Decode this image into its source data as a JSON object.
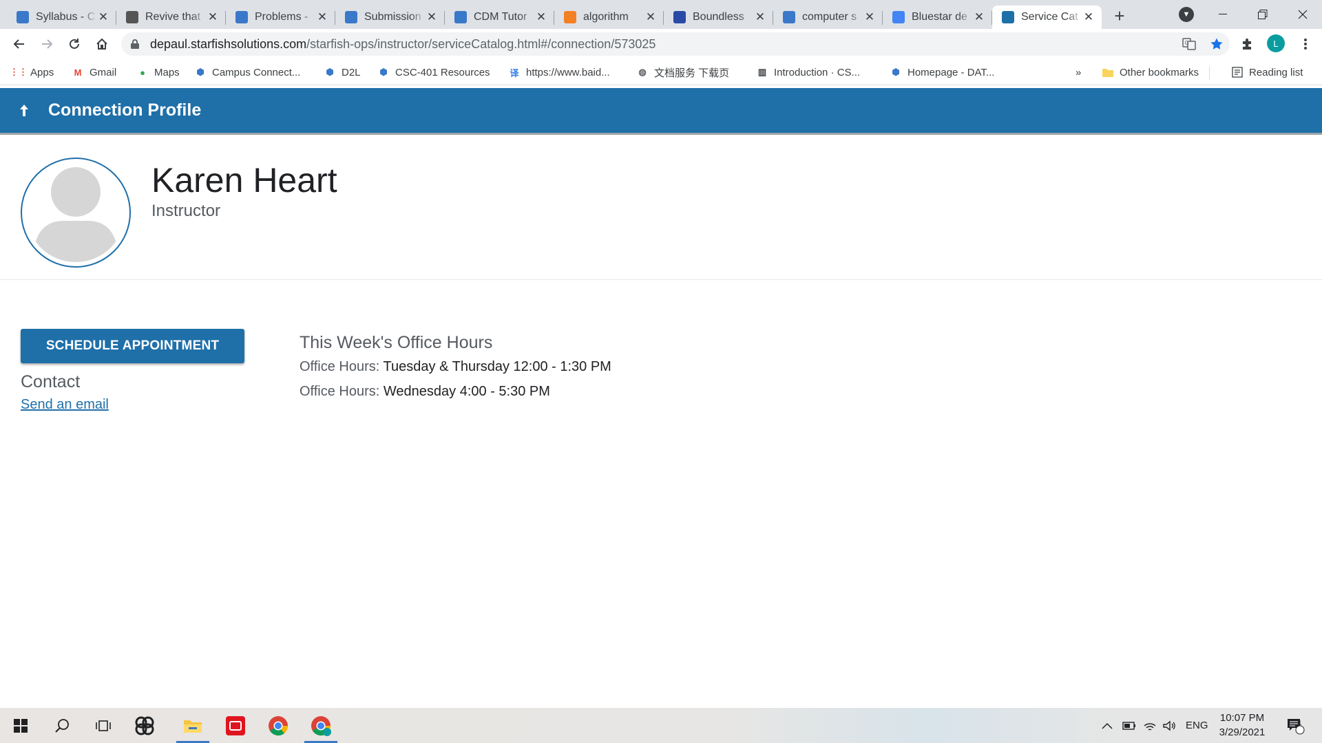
{
  "browser": {
    "tabs": [
      {
        "title": "Syllabus - C",
        "icon": "depaul-shield-icon",
        "color": "#3a78c9",
        "active": false
      },
      {
        "title": "Revive that",
        "icon": "ebook-icon",
        "color": "#555555",
        "active": false
      },
      {
        "title": "Problems -",
        "icon": "depaul-shield-icon",
        "color": "#3a78c9",
        "active": false
      },
      {
        "title": "Submission",
        "icon": "depaul-shield-icon",
        "color": "#3a78c9",
        "active": false
      },
      {
        "title": "CDM Tutor",
        "icon": "depaul-shield-icon",
        "color": "#3a78c9",
        "active": false
      },
      {
        "title": "algorithm",
        "icon": "stackoverflow-icon",
        "color": "#f48024",
        "active": false
      },
      {
        "title": "Boundless",
        "icon": "boundless-b-icon",
        "color": "#2a4aa8",
        "active": false
      },
      {
        "title": "computer s",
        "icon": "diamond-icon",
        "color": "#3a78c9",
        "active": false
      },
      {
        "title": "Bluestar de",
        "icon": "google-icon",
        "color": "#4285f4",
        "active": false
      },
      {
        "title": "Service Cat",
        "icon": "starfish-icon",
        "color": "#1f6fa8",
        "active": true
      }
    ],
    "url_host": "depaul.starfishsolutions.com",
    "url_path": "/starfish-ops/instructor/serviceCatalog.html#/connection/573025",
    "profile_initial": "L",
    "bookmarks": [
      {
        "label": "Apps",
        "icon": "apps-grid-icon"
      },
      {
        "label": "Gmail",
        "icon": "gmail-icon"
      },
      {
        "label": "Maps",
        "icon": "maps-pin-icon"
      },
      {
        "label": "Campus Connect...",
        "icon": "depaul-shield-icon"
      },
      {
        "label": "D2L",
        "icon": "depaul-shield-icon"
      },
      {
        "label": "CSC-401 Resources",
        "icon": "depaul-shield-icon"
      },
      {
        "label": "https://www.baid...",
        "icon": "baidu-translate-icon"
      },
      {
        "label": "文档服务 下载页",
        "icon": "globe-icon"
      },
      {
        "label": "Introduction · CS...",
        "icon": "book-icon"
      },
      {
        "label": "Homepage - DAT...",
        "icon": "depaul-shield-icon"
      }
    ],
    "bookmarks_overflow": "»",
    "other_bookmarks": "Other bookmarks",
    "reading_list": "Reading list"
  },
  "page": {
    "header_title": "Connection Profile",
    "person_name": "Karen Heart",
    "person_role": "Instructor",
    "schedule_button": "SCHEDULE APPOINTMENT",
    "contact_heading": "Contact",
    "email_link": "Send an email",
    "office_hours_title": "This Week's Office Hours",
    "office_hours": [
      {
        "label": "Office Hours:",
        "value": "Tuesday & Thursday 12:00 - 1:30 PM"
      },
      {
        "label": "Office Hours:",
        "value": "Wednesday 4:00 - 5:30 PM"
      }
    ],
    "brand_color": "#1f6fa8"
  },
  "taskbar": {
    "language": "ENG",
    "time": "10:07 PM",
    "date": "3/29/2021",
    "notification_count": "1"
  }
}
